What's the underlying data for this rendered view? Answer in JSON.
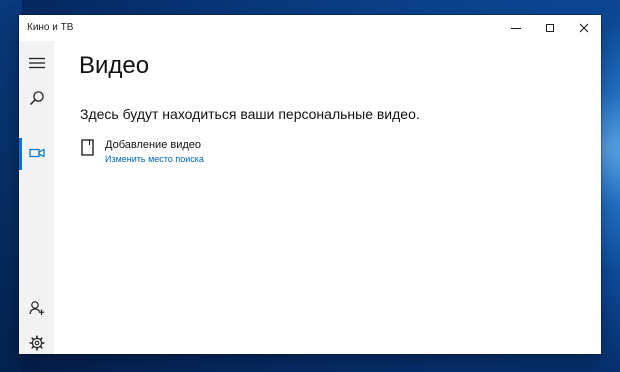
{
  "window": {
    "title": "Кино и ТВ",
    "controls": {
      "minimize_icon": "minimize-icon",
      "maximize_icon": "maximize-icon",
      "close_icon": "close-icon"
    }
  },
  "sidebar": {
    "items": [
      {
        "name": "menu",
        "icon": "hamburger-icon"
      },
      {
        "name": "search",
        "icon": "search-icon"
      },
      {
        "name": "video",
        "icon": "video-camera-icon",
        "active": true
      },
      {
        "name": "account",
        "icon": "person-add-icon"
      },
      {
        "name": "settings",
        "icon": "gear-icon"
      }
    ],
    "accent": "#0078d7"
  },
  "main": {
    "title": "Видео",
    "message": "Здесь будут находиться ваши персональные видео.",
    "add_video": {
      "label": "Добавление видео",
      "link": "Изменить место поиска",
      "icon": "document-icon"
    },
    "link_color": "#0067b8"
  }
}
